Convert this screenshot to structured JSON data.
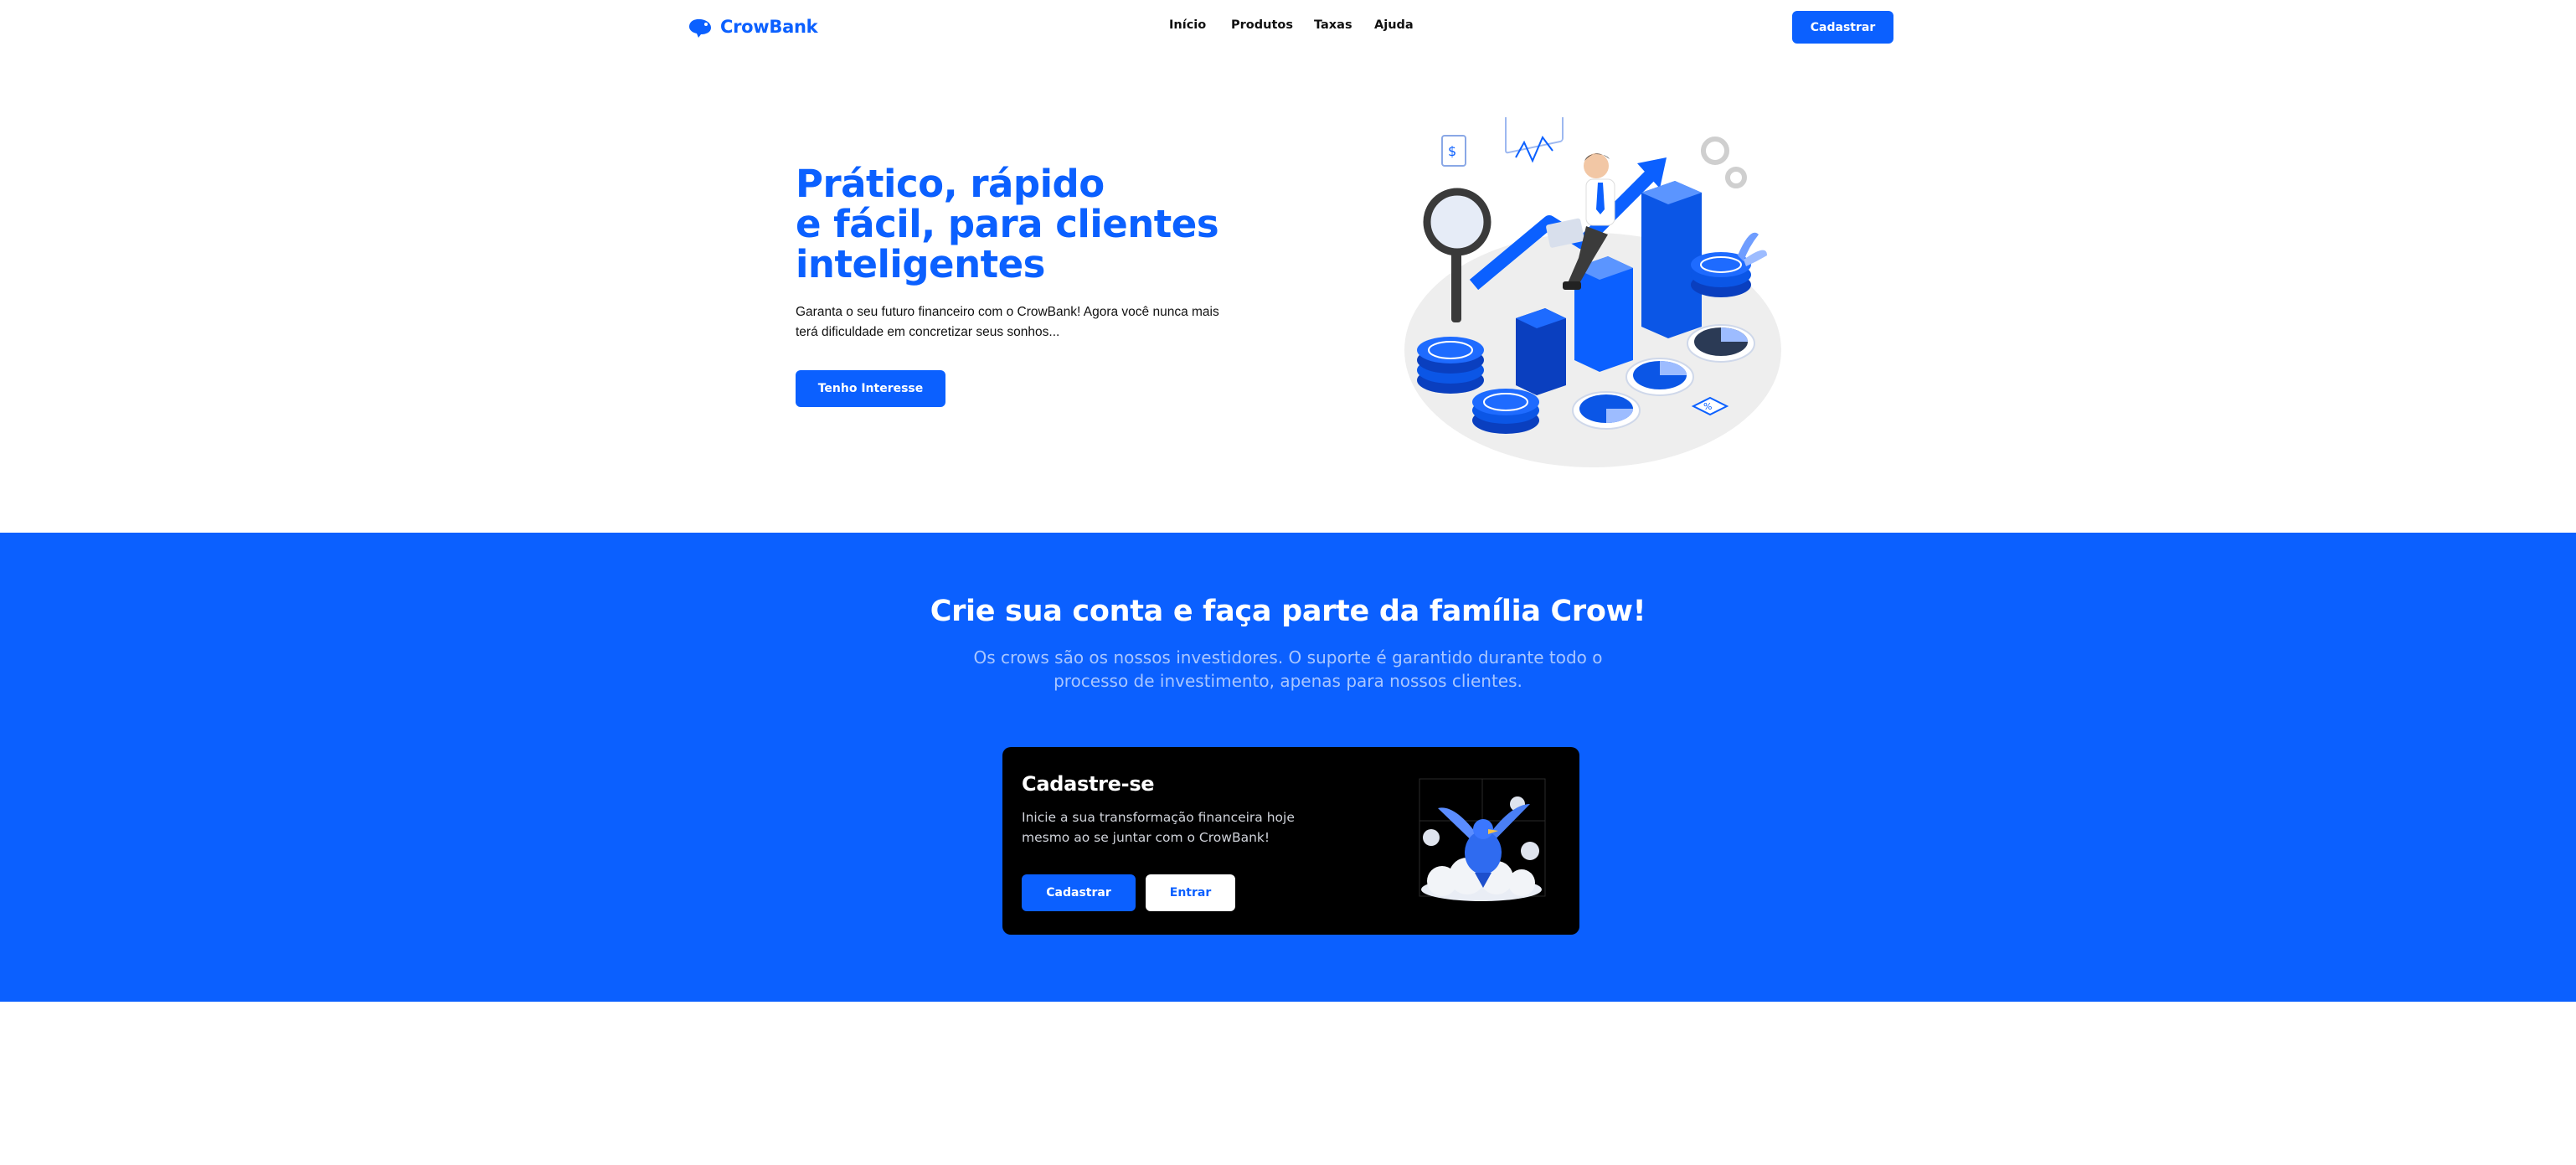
{
  "brand": {
    "name": "CrowBank",
    "accent": "#0b60ff"
  },
  "nav": {
    "items": [
      "Início",
      "Produtos",
      "Taxas",
      "Ajuda"
    ],
    "cta": "Cadastrar"
  },
  "hero": {
    "title_lines": [
      "Prático, rápido",
      "e fácil, para clientes",
      "inteligentes"
    ],
    "subtitle": "Garanta o seu futuro financeiro com o CrowBank! Agora você nunca mais terá dificuldade em concretizar seus sonhos...",
    "cta": "Tenho Interesse",
    "illustration": "investment-growth-illustration"
  },
  "signup_section": {
    "title": "Crie sua conta e faça parte da família Crow!",
    "subtitle": "Os crows são os nossos investidores. O suporte é garantido durante todo o processo de investimento, apenas para nossos clientes.",
    "card": {
      "title": "Cadastre-se",
      "text": "Inicie a sua transformação financeira hoje mesmo ao se juntar com o CrowBank!",
      "primary_button": "Cadastrar",
      "secondary_button": "Entrar",
      "illustration": "bird-on-clouds-illustration"
    }
  },
  "colors": {
    "primary": "#0b60ff",
    "band_subtitle": "#a9c6ff",
    "card_background": "#000000"
  }
}
